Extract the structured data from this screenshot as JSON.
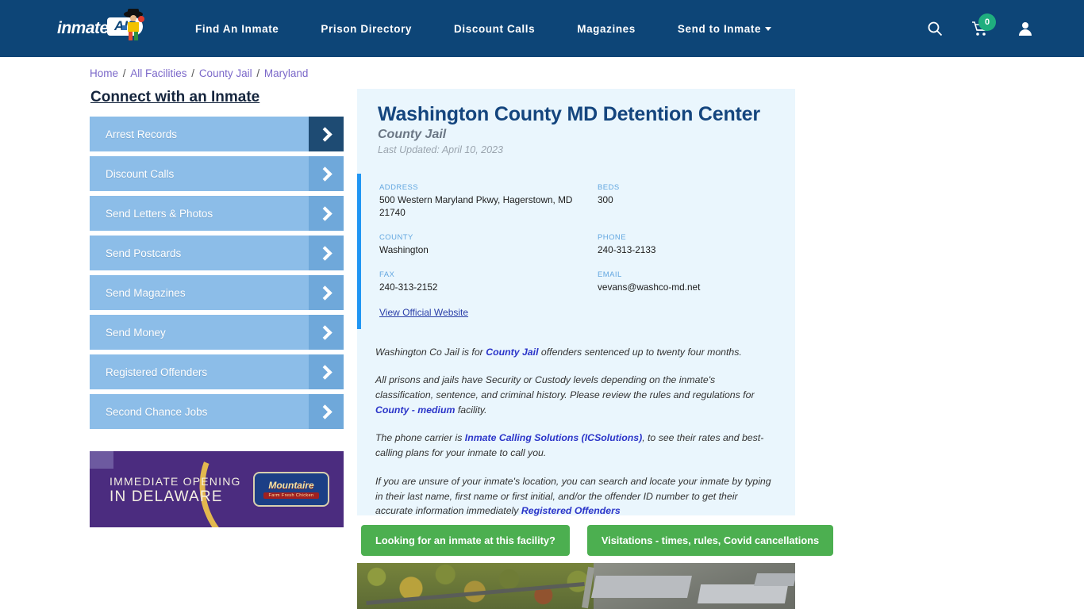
{
  "header": {
    "logo": {
      "text": "inmate",
      "badge": "AID",
      "icon": "inmate-aid-logo"
    },
    "nav": [
      {
        "label": "Find An Inmate",
        "has_caret": false
      },
      {
        "label": "Prison Directory",
        "has_caret": false
      },
      {
        "label": "Discount Calls",
        "has_caret": false
      },
      {
        "label": "Magazines",
        "has_caret": false
      },
      {
        "label": "Send to Inmate",
        "has_caret": true
      }
    ],
    "icons": {
      "search": "search-icon",
      "cart": "shopping-cart-icon",
      "cart_count": "0",
      "account": "user-account-icon"
    },
    "bg_color": "#0d4577"
  },
  "breadcrumb": {
    "items": [
      "Home",
      "All Facilities",
      "County Jail",
      "Maryland"
    ],
    "separator": "/"
  },
  "sidebar": {
    "title": "Connect with an Inmate",
    "items": [
      {
        "label": "Arrest Records",
        "active": true
      },
      {
        "label": "Discount Calls",
        "active": false
      },
      {
        "label": "Send Letters & Photos",
        "active": false
      },
      {
        "label": "Send Postcards",
        "active": false
      },
      {
        "label": "Send Magazines",
        "active": false
      },
      {
        "label": "Send Money",
        "active": false
      },
      {
        "label": "Registered Offenders",
        "active": false
      },
      {
        "label": "Second Chance Jobs",
        "active": false
      }
    ],
    "ad": {
      "line1": "IMMEDIATE OPENING",
      "line2": "IN DELAWARE",
      "brand": "Mountaire",
      "brand_sub": "Farm Fresh Chicken"
    }
  },
  "facility": {
    "name": "Washington County MD Detention Center",
    "type": "County Jail",
    "last_updated": "Last Updated: April 10, 2023",
    "fields": [
      {
        "label": "ADDRESS",
        "value": "500 Western Maryland Pkwy, Hagerstown, MD 21740"
      },
      {
        "label": "BEDS",
        "value": "300"
      },
      {
        "label": "COUNTY",
        "value": "Washington"
      },
      {
        "label": "PHONE",
        "value": "240-313-2133"
      },
      {
        "label": "FAX",
        "value": "240-313-2152"
      },
      {
        "label": "EMAIL",
        "value": "vevans@washco-md.net"
      }
    ],
    "official_website_link": "View Official Website",
    "description": {
      "p1_a": "Washington Co Jail is for ",
      "p1_link": "County Jail",
      "p1_b": " offenders sentenced up to twenty four months.",
      "p2_a": "All prisons and jails have Security or Custody levels depending on the inmate's classification, sentence, and criminal history. Please review the rules and regulations for ",
      "p2_link": "County - medium",
      "p2_b": " facility.",
      "p3_a": "The phone carrier is ",
      "p3_link": "Inmate Calling Solutions (ICSolutions)",
      "p3_b": ", to see their rates and best-calling plans for your inmate to call you.",
      "p4_a": "If you are unsure of your inmate's location, you can search and locate your inmate by typing in their last name, first name or first initial, and/or the offender ID number to get their accurate information immediately ",
      "p4_link": "Registered Offenders"
    }
  },
  "cta": {
    "buttons": [
      "Looking for an inmate at this facility?",
      "Visitations - times, rules, Covid cancellations"
    ],
    "color": "#4caf50"
  },
  "photo": {
    "alt": "aerial-view-of-detention-center"
  },
  "colors": {
    "header_navy": "#0d4577",
    "card_bg": "#eaf6fd",
    "accent_blue": "#2196f3",
    "sidebar_button": "#8cbde8",
    "link_blue": "#2b35c9",
    "breadcrumb_purple": "#7b68c9",
    "badge_green": "#1fae7e"
  }
}
